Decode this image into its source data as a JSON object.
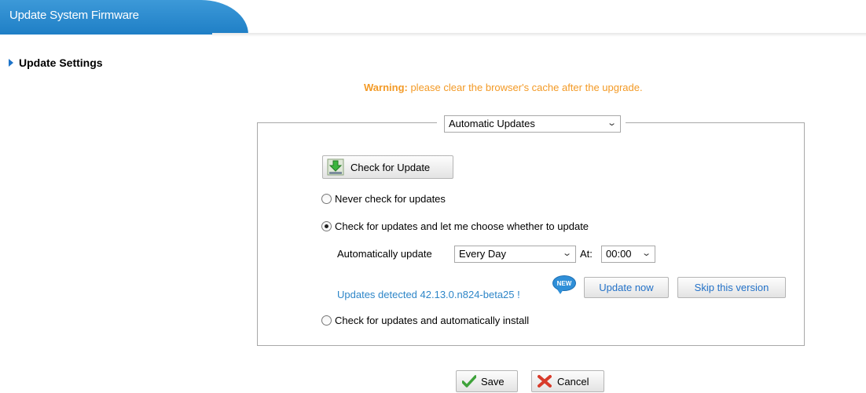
{
  "header": {
    "title": "Update System Firmware"
  },
  "section": {
    "heading": "Update Settings"
  },
  "warning": {
    "label": "Warning:",
    "text": " please clear the browser's cache after the upgrade."
  },
  "mode_select": {
    "value": "Automatic Updates"
  },
  "check_button": {
    "label": "Check for Update",
    "icon": "download-icon"
  },
  "options": {
    "never": {
      "label": "Never check for updates",
      "checked": false
    },
    "choose": {
      "label": "Check for updates and let me choose whether to update",
      "checked": true
    },
    "auto_install": {
      "label": "Check for updates and automatically install",
      "checked": false
    }
  },
  "schedule": {
    "label": "Automatically update",
    "frequency": "Every Day",
    "at_label": "At:",
    "time": "00:00"
  },
  "update_info": {
    "text": "Updates detected 42.13.0.n824-beta25 !",
    "badge": "NEW",
    "update_now_label": "Update now",
    "skip_label": "Skip this version"
  },
  "actions": {
    "save_label": "Save",
    "cancel_label": "Cancel"
  },
  "colors": {
    "accent": "#2f8fd8",
    "warning": "#f39a26",
    "link": "#2e86c8"
  }
}
